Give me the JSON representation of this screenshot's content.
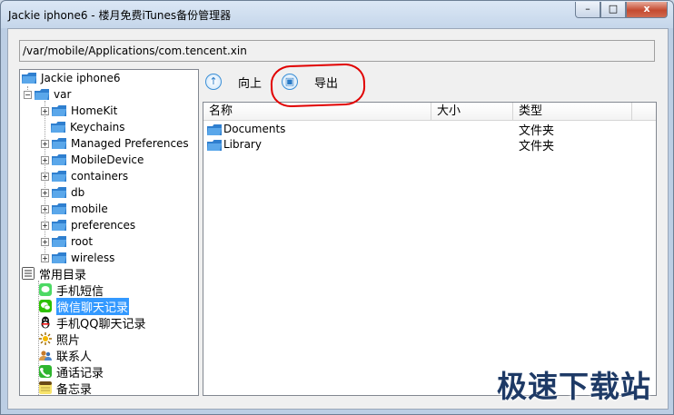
{
  "window": {
    "title": "Jackie iphone6 - 楼月免费iTunes备份管理器",
    "caption_min": "–",
    "caption_max": "□",
    "caption_close": "x"
  },
  "path": "/var/mobile/Applications/com.tencent.xin",
  "tree": {
    "root": "Jackie iphone6",
    "var": "var",
    "children": [
      "HomeKit",
      "Keychains",
      "Managed Preferences",
      "MobileDevice",
      "containers",
      "db",
      "mobile",
      "preferences",
      "root",
      "wireless"
    ],
    "common_dir": "常用目录",
    "categories": [
      "手机短信",
      "微信聊天记录",
      "手机QQ聊天记录",
      "照片",
      "联系人",
      "通话记录",
      "备忘录"
    ],
    "selected_category": "微信聊天记录"
  },
  "toolbar": {
    "up_label": "向上",
    "export_label": "导出",
    "up_icon": "arrow-up-circle-icon",
    "export_icon": "save-circle-icon"
  },
  "list": {
    "columns": [
      "名称",
      "大小",
      "类型"
    ],
    "rows": [
      {
        "name": "Documents",
        "size": "",
        "type": "文件夹"
      },
      {
        "name": "Library",
        "size": "",
        "type": "文件夹"
      }
    ]
  },
  "watermark": "极速下载站",
  "colors": {
    "selection": "#3399ff",
    "annotation": "#e10000",
    "folder": "#2f7fcf"
  }
}
